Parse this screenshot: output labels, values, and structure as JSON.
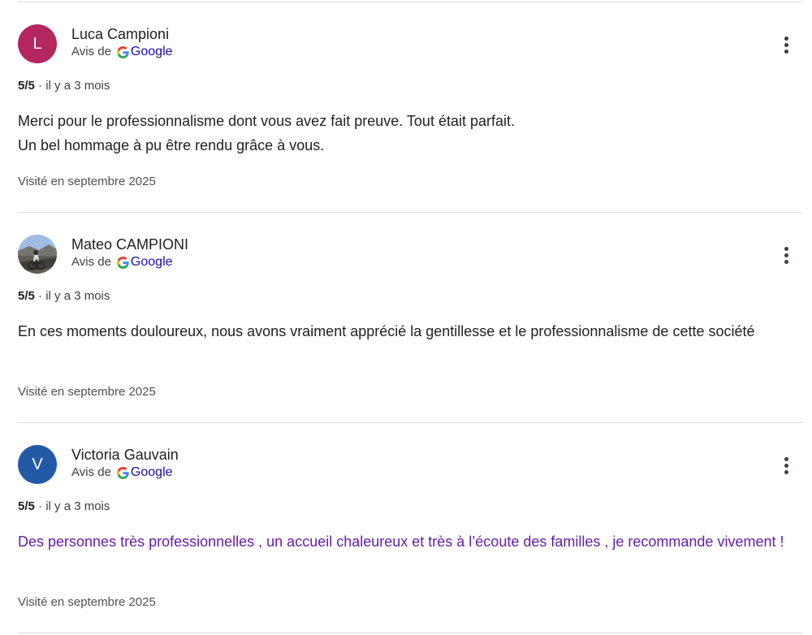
{
  "reviews": [
    {
      "author": "Luca Campioni",
      "avatar_letter": "L",
      "avatar_color": "#b3265e",
      "source_prefix": "Avis de",
      "source_name": "Google",
      "score": "5/5",
      "age": "· il y a 3 mois",
      "text": "Merci pour le professionnalisme dont vous avez fait preuve. Tout était parfait.\nUn bel hommage à pu être rendu grâce à vous.",
      "visited": "Visité en septembre 2025"
    },
    {
      "author": "Mateo CAMPIONI",
      "avatar_letter": "",
      "avatar_color": "",
      "source_prefix": "Avis de",
      "source_name": "Google",
      "score": "5/5",
      "age": "· il y a 3 mois",
      "text": "En ces moments douloureux, nous avons vraiment apprécié la gentillesse et le professionnalisme de cette société",
      "visited": "Visité en septembre 2025"
    },
    {
      "author": "Victoria Gauvain",
      "avatar_letter": "V",
      "avatar_color": "#245aa5",
      "source_prefix": "Avis de",
      "source_name": "Google",
      "score": "5/5",
      "age": "· il y a 3 mois",
      "text": "Des personnes très professionnelles , un accueil chaleureux et très à l’écoute des familles , je recommande vivement !",
      "visited": "Visité en septembre 2025"
    }
  ],
  "icons": {
    "google": "google-g-icon",
    "menu": "more-vert-icon",
    "photo_avatar": "cyclist-photo-avatar"
  },
  "colors": {
    "link_blue": "#1a0dab",
    "visited_purple": "#681da8",
    "divider": "#dadce0"
  }
}
